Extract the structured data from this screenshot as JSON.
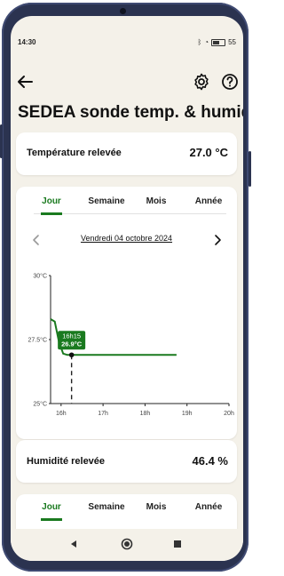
{
  "status_bar": {
    "time": "14:30",
    "battery": "55"
  },
  "page": {
    "title": "SEDEA sonde temp. & humid"
  },
  "temperature": {
    "label": "Température relevée",
    "value": "27.0 °C"
  },
  "tabs": [
    "Jour",
    "Semaine",
    "Mois",
    "Année"
  ],
  "date_nav": {
    "date": "Vendredi 04 octobre 2024"
  },
  "tooltip": {
    "time": "16h15",
    "value": "26.9°C"
  },
  "humidity": {
    "label": "Humidité relevée",
    "value": "46.4 %"
  },
  "tabs2": [
    "Jour",
    "Semaine",
    "Mois",
    "Année"
  ],
  "colors": {
    "accent": "#1a7a1f",
    "background": "#f4f1e9"
  },
  "chart_data": {
    "type": "line",
    "y_tick_labels": [
      "30°C",
      "27.5°C",
      "25°C"
    ],
    "x_tick_labels": [
      "16h",
      "17h",
      "18h",
      "19h",
      "20h"
    ],
    "ylim": [
      25,
      30
    ],
    "xlim": [
      15.75,
      20
    ],
    "series": [
      {
        "x": [
          15.75,
          15.85,
          15.95,
          16.05,
          16.15,
          16.25,
          16.5,
          17,
          17.5,
          18,
          18.5,
          18.75
        ],
        "y": [
          28.3,
          28.2,
          27.4,
          26.95,
          26.9,
          26.9,
          26.9,
          26.9,
          26.9,
          26.9,
          26.9,
          26.9
        ]
      }
    ],
    "selected": {
      "x": 16.25,
      "y": 26.9
    }
  }
}
